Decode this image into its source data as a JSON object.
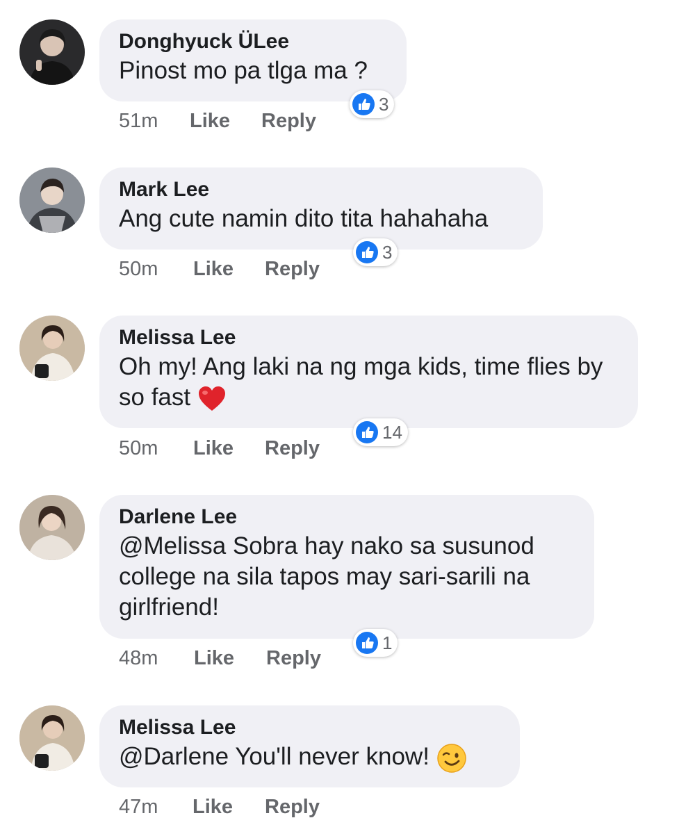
{
  "comments": [
    {
      "author": "Donghyuck ÜLee",
      "text": "Pinost mo pa tlga ma ?",
      "time": "51m",
      "like_label": "Like",
      "reply_label": "Reply",
      "reactions": "3",
      "avatar_icon": "avatar-icon"
    },
    {
      "author": "Mark Lee",
      "text": "Ang cute namin dito tita hahahaha",
      "time": "50m",
      "like_label": "Like",
      "reply_label": "Reply",
      "reactions": "3",
      "avatar_icon": "avatar-icon"
    },
    {
      "author": "Melissa Lee",
      "text": "Oh my! Ang laki na ng mga kids, time flies by so fast",
      "emoji": "red-heart-icon",
      "time": "50m",
      "like_label": "Like",
      "reply_label": "Reply",
      "reactions": "14",
      "avatar_icon": "avatar-icon"
    },
    {
      "author": "Darlene Lee",
      "text": "@Melissa Sobra hay nako sa susunod college na sila tapos may sari-sarili na girlfriend!",
      "time": "48m",
      "like_label": "Like",
      "reply_label": "Reply",
      "reactions": "1",
      "avatar_icon": "avatar-icon"
    },
    {
      "author": "Melissa Lee",
      "text": "@Darlene You'll never know!",
      "emoji": "winking-face-icon",
      "time": "47m",
      "like_label": "Like",
      "reply_label": "Reply",
      "reactions": "",
      "avatar_icon": "avatar-icon"
    }
  ],
  "colors": {
    "bubble": "#f0f0f5",
    "like_blue": "#1877f2",
    "meta_gray": "#65676b",
    "heart_red": "#e0232b"
  }
}
